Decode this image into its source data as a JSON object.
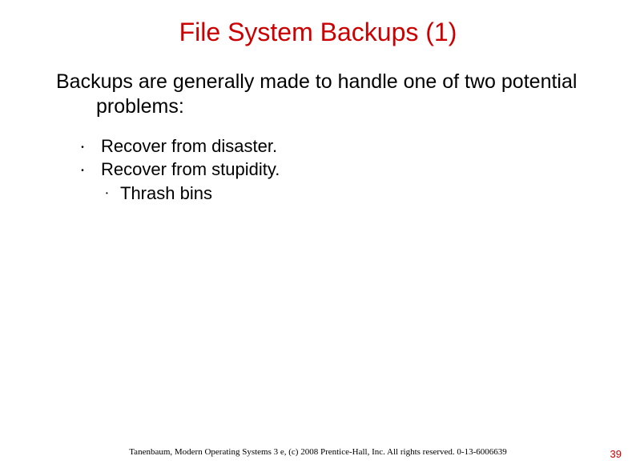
{
  "title": "File System Backups (1)",
  "intro": "Backups are generally made to handle one of two potential problems:",
  "bullets": [
    {
      "text": "Recover from disaster.",
      "sub": []
    },
    {
      "text": "Recover from stupidity.",
      "sub": [
        "Thrash bins"
      ]
    }
  ],
  "footer": "Tanenbaum, Modern Operating Systems 3 e, (c) 2008 Prentice-Hall, Inc. All rights reserved. 0-13-6006639",
  "page_number": "39"
}
